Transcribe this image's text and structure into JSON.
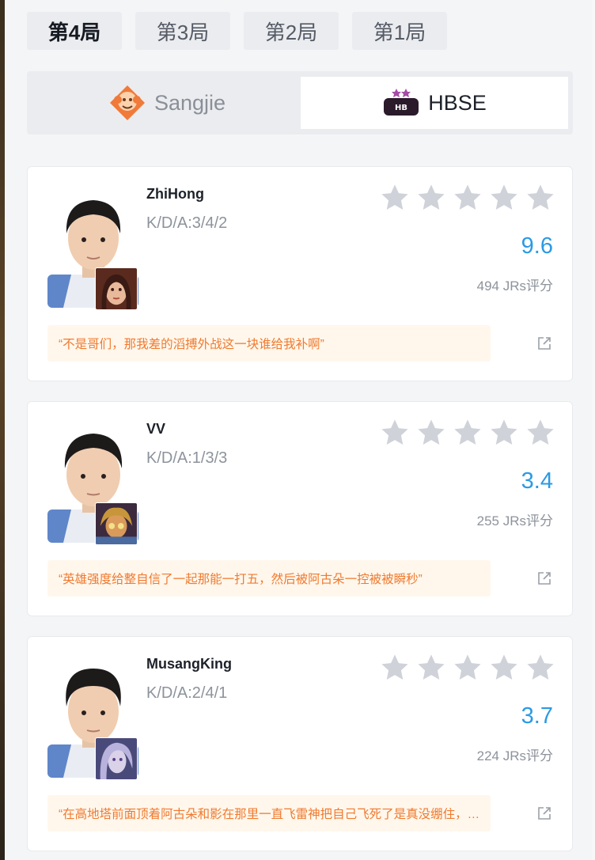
{
  "tabs": [
    "第4局",
    "第3局",
    "第2局",
    "第1局"
  ],
  "teams": [
    {
      "name": "Sangjie",
      "logo": "monkey-logo-icon",
      "selected": false
    },
    {
      "name": "HBSE",
      "logo": "homebois-logo-icon",
      "selected": true
    }
  ],
  "players": [
    {
      "name": "ZhiHong",
      "kda": "K/D/A:3/4/2",
      "score": "9.6",
      "rating_count": "494 JRs评分",
      "quote": "“不是哥们，那我差的滔搏外战这一块谁给我补啊”",
      "hero": "hero-portrait-1"
    },
    {
      "name": "VV",
      "kda": "K/D/A:1/3/3",
      "score": "3.4",
      "rating_count": "255 JRs评分",
      "quote": "“英雄强度给整自信了一起那能一打五，然后被阿古朵一控被被瞬秒”",
      "hero": "hero-portrait-2"
    },
    {
      "name": "MusangKing",
      "kda": "K/D/A:2/4/1",
      "score": "3.7",
      "rating_count": "224 JRs评分",
      "quote": "“在高地塔前面顶着阿古朵和影在那里一直飞雷神把自己飞死了是真没绷住，…",
      "hero": "hero-portrait-3"
    }
  ],
  "colors": {
    "score_blue": "#2b9ae4",
    "quote_orange": "#f07a2f",
    "quote_bg": "#fff7ec",
    "star_gray": "#cfd2d9"
  }
}
